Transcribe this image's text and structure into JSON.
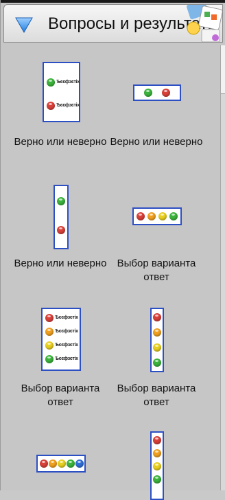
{
  "panel": {
    "title": "Вопросы и результаты",
    "colors": {
      "green": "#3cb43c",
      "red": "#d9413a",
      "orange": "#f0a020",
      "yellow": "#e8d020",
      "blue": "#2f6fd6",
      "border": "#2d4fc4"
    }
  },
  "items": [
    {
      "label": "Верно или неверно",
      "type": "true-false-list",
      "row_text": "Ѣєєфзєтіх"
    },
    {
      "label": "Верно или неверно",
      "type": "true-false-horizontal"
    },
    {
      "label": "Верно или неверно",
      "type": "true-false-vertical"
    },
    {
      "label": "Выбор варианта ответ",
      "type": "choice-horizontal-4"
    },
    {
      "label": "Выбор варианта ответ",
      "type": "choice-list-4",
      "row_text": "Ѣєєфзєтіх"
    },
    {
      "label": "Выбор варианта ответ",
      "type": "choice-vertical-4"
    },
    {
      "label": "",
      "type": "choice-horizontal-5"
    },
    {
      "label": "",
      "type": "choice-vertical-5"
    }
  ]
}
